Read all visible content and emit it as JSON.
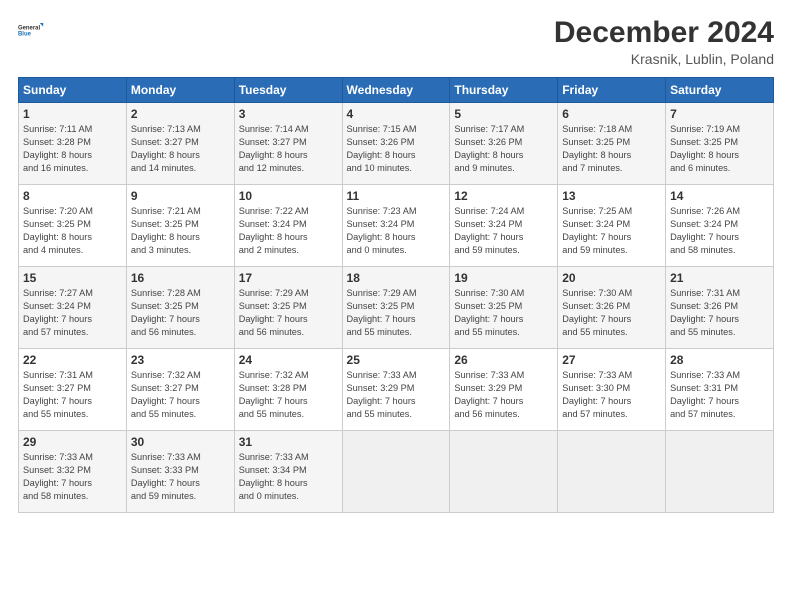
{
  "logo": {
    "line1": "General",
    "line2": "Blue"
  },
  "title": "December 2024",
  "subtitle": "Krasnik, Lublin, Poland",
  "days_header": [
    "Sunday",
    "Monday",
    "Tuesday",
    "Wednesday",
    "Thursday",
    "Friday",
    "Saturday"
  ],
  "weeks": [
    [
      {
        "day": "1",
        "info": "Sunrise: 7:11 AM\nSunset: 3:28 PM\nDaylight: 8 hours\nand 16 minutes."
      },
      {
        "day": "2",
        "info": "Sunrise: 7:13 AM\nSunset: 3:27 PM\nDaylight: 8 hours\nand 14 minutes."
      },
      {
        "day": "3",
        "info": "Sunrise: 7:14 AM\nSunset: 3:27 PM\nDaylight: 8 hours\nand 12 minutes."
      },
      {
        "day": "4",
        "info": "Sunrise: 7:15 AM\nSunset: 3:26 PM\nDaylight: 8 hours\nand 10 minutes."
      },
      {
        "day": "5",
        "info": "Sunrise: 7:17 AM\nSunset: 3:26 PM\nDaylight: 8 hours\nand 9 minutes."
      },
      {
        "day": "6",
        "info": "Sunrise: 7:18 AM\nSunset: 3:25 PM\nDaylight: 8 hours\nand 7 minutes."
      },
      {
        "day": "7",
        "info": "Sunrise: 7:19 AM\nSunset: 3:25 PM\nDaylight: 8 hours\nand 6 minutes."
      }
    ],
    [
      {
        "day": "8",
        "info": "Sunrise: 7:20 AM\nSunset: 3:25 PM\nDaylight: 8 hours\nand 4 minutes."
      },
      {
        "day": "9",
        "info": "Sunrise: 7:21 AM\nSunset: 3:25 PM\nDaylight: 8 hours\nand 3 minutes."
      },
      {
        "day": "10",
        "info": "Sunrise: 7:22 AM\nSunset: 3:24 PM\nDaylight: 8 hours\nand 2 minutes."
      },
      {
        "day": "11",
        "info": "Sunrise: 7:23 AM\nSunset: 3:24 PM\nDaylight: 8 hours\nand 0 minutes."
      },
      {
        "day": "12",
        "info": "Sunrise: 7:24 AM\nSunset: 3:24 PM\nDaylight: 7 hours\nand 59 minutes."
      },
      {
        "day": "13",
        "info": "Sunrise: 7:25 AM\nSunset: 3:24 PM\nDaylight: 7 hours\nand 59 minutes."
      },
      {
        "day": "14",
        "info": "Sunrise: 7:26 AM\nSunset: 3:24 PM\nDaylight: 7 hours\nand 58 minutes."
      }
    ],
    [
      {
        "day": "15",
        "info": "Sunrise: 7:27 AM\nSunset: 3:24 PM\nDaylight: 7 hours\nand 57 minutes."
      },
      {
        "day": "16",
        "info": "Sunrise: 7:28 AM\nSunset: 3:25 PM\nDaylight: 7 hours\nand 56 minutes."
      },
      {
        "day": "17",
        "info": "Sunrise: 7:29 AM\nSunset: 3:25 PM\nDaylight: 7 hours\nand 56 minutes."
      },
      {
        "day": "18",
        "info": "Sunrise: 7:29 AM\nSunset: 3:25 PM\nDaylight: 7 hours\nand 55 minutes."
      },
      {
        "day": "19",
        "info": "Sunrise: 7:30 AM\nSunset: 3:25 PM\nDaylight: 7 hours\nand 55 minutes."
      },
      {
        "day": "20",
        "info": "Sunrise: 7:30 AM\nSunset: 3:26 PM\nDaylight: 7 hours\nand 55 minutes."
      },
      {
        "day": "21",
        "info": "Sunrise: 7:31 AM\nSunset: 3:26 PM\nDaylight: 7 hours\nand 55 minutes."
      }
    ],
    [
      {
        "day": "22",
        "info": "Sunrise: 7:31 AM\nSunset: 3:27 PM\nDaylight: 7 hours\nand 55 minutes."
      },
      {
        "day": "23",
        "info": "Sunrise: 7:32 AM\nSunset: 3:27 PM\nDaylight: 7 hours\nand 55 minutes."
      },
      {
        "day": "24",
        "info": "Sunrise: 7:32 AM\nSunset: 3:28 PM\nDaylight: 7 hours\nand 55 minutes."
      },
      {
        "day": "25",
        "info": "Sunrise: 7:33 AM\nSunset: 3:29 PM\nDaylight: 7 hours\nand 55 minutes."
      },
      {
        "day": "26",
        "info": "Sunrise: 7:33 AM\nSunset: 3:29 PM\nDaylight: 7 hours\nand 56 minutes."
      },
      {
        "day": "27",
        "info": "Sunrise: 7:33 AM\nSunset: 3:30 PM\nDaylight: 7 hours\nand 57 minutes."
      },
      {
        "day": "28",
        "info": "Sunrise: 7:33 AM\nSunset: 3:31 PM\nDaylight: 7 hours\nand 57 minutes."
      }
    ],
    [
      {
        "day": "29",
        "info": "Sunrise: 7:33 AM\nSunset: 3:32 PM\nDaylight: 7 hours\nand 58 minutes."
      },
      {
        "day": "30",
        "info": "Sunrise: 7:33 AM\nSunset: 3:33 PM\nDaylight: 7 hours\nand 59 minutes."
      },
      {
        "day": "31",
        "info": "Sunrise: 7:33 AM\nSunset: 3:34 PM\nDaylight: 8 hours\nand 0 minutes."
      },
      null,
      null,
      null,
      null
    ]
  ]
}
